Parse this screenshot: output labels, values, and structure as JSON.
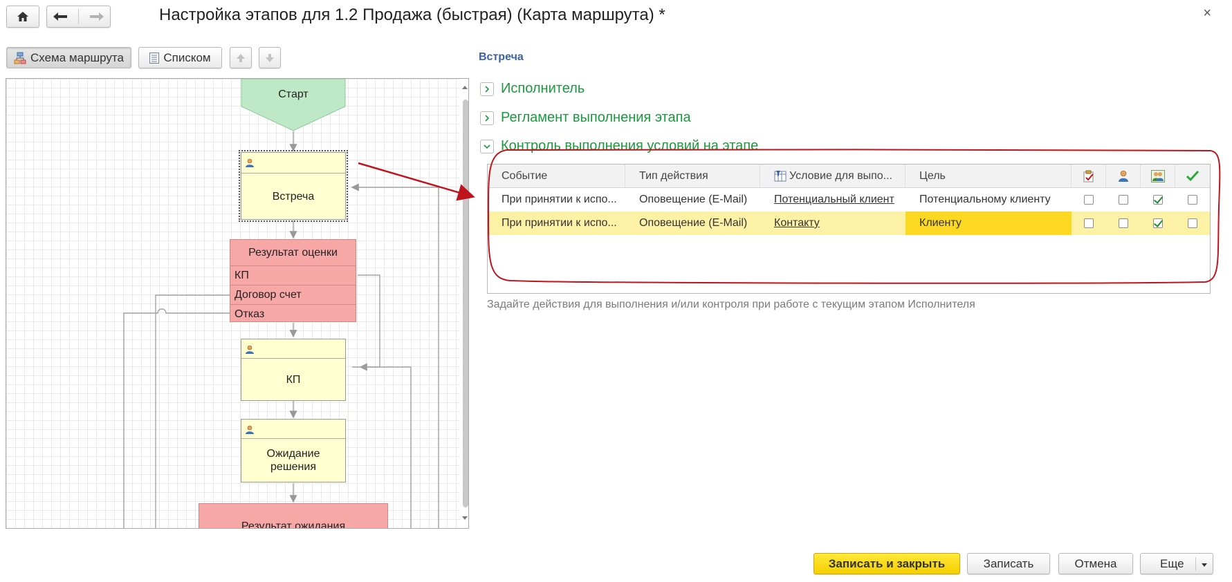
{
  "window": {
    "title": "Настройка этапов для 1.2 Продажа (быстрая) (Карта маршрута) *",
    "close_glyph": "×"
  },
  "nav": {
    "home_icon": "home-icon",
    "back_icon": "arrow-left-icon",
    "forward_icon": "arrow-right-icon"
  },
  "toolbar": {
    "scheme_label": "Схема маршрута",
    "list_label": "Списком"
  },
  "diagram": {
    "start": "Старт",
    "meeting": "Встреча",
    "evaluation_result": {
      "title": "Результат оценки",
      "branches": [
        "КП",
        "Договор счет",
        "Отказ"
      ]
    },
    "kp": "КП",
    "waiting": "Ожидание решения",
    "waiting_result": "Результат ожидания"
  },
  "details": {
    "current_stage": "Встреча",
    "sections": [
      {
        "label": "Исполнитель",
        "expanded": false
      },
      {
        "label": "Регламент выполнения этапа",
        "expanded": false
      },
      {
        "label": "Контроль выполнения условий на этапе",
        "expanded": true
      }
    ],
    "table": {
      "headers": [
        "Событие",
        "Тип действия",
        "Условие для выпо...",
        "Цель"
      ],
      "icon_headers": [
        "clipboard-icon",
        "user-icon",
        "users-icon",
        "check-icon"
      ],
      "rows": [
        {
          "event": "При принятии к испо...",
          "action": "Оповещение (E-Mail)",
          "condition": "Потенциальный клиент",
          "target": "Потенциальному клиенту",
          "flags": [
            false,
            false,
            true,
            false
          ]
        },
        {
          "event": "При принятии к испо...",
          "action": "Оповещение (E-Mail)",
          "condition": "Контакту",
          "target": "Клиенту",
          "flags": [
            false,
            false,
            true,
            false
          ]
        }
      ]
    },
    "hint": "Задайте действия для выполнения и/или контроля при работе с текущим этапом Исполнителя"
  },
  "footer": {
    "save_close": "Записать и закрыть",
    "save": "Записать",
    "cancel": "Отмена",
    "more": "Еще"
  },
  "colors": {
    "accent_green": "#1a9a3c",
    "primary_yellow": "#f5cf00",
    "annotation_red": "#c0141c",
    "node_yellow": "#ffffd0",
    "node_red": "#f8a7a7",
    "node_green": "#bfe8c6"
  }
}
